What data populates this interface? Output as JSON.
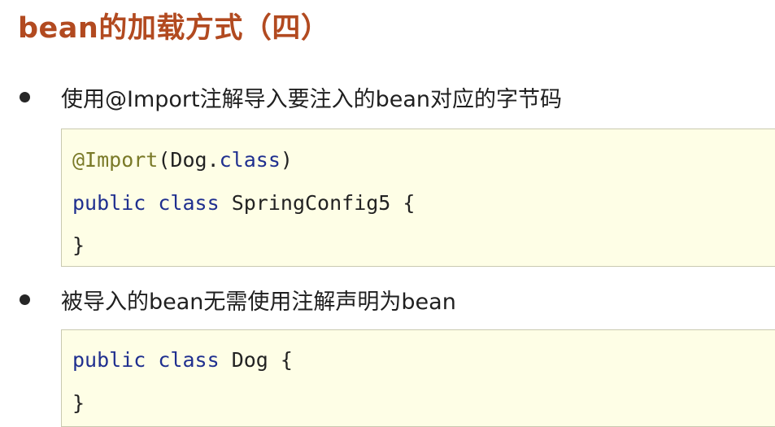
{
  "title": "bean的加载方式（四）",
  "bullets": [
    "使用@Import注解导入要注入的bean对应的字节码",
    "被导入的bean无需使用注解声明为bean"
  ],
  "code1": {
    "line1": {
      "annotation": "@Import",
      "open": "(Dog.",
      "class_kw": "class",
      "close": ")"
    },
    "line2": {
      "public_kw": "public",
      "class_kw": "class",
      "rest": " SpringConfig5 {"
    },
    "line3": "}"
  },
  "code2": {
    "line1": {
      "public_kw": "public",
      "class_kw": "class",
      "rest": " Dog {"
    },
    "line2": "}"
  },
  "colors": {
    "title": "#b24a20",
    "code_background": "#fefee6",
    "keyword": "#1f2f8f",
    "annotation": "#7a7a28"
  }
}
